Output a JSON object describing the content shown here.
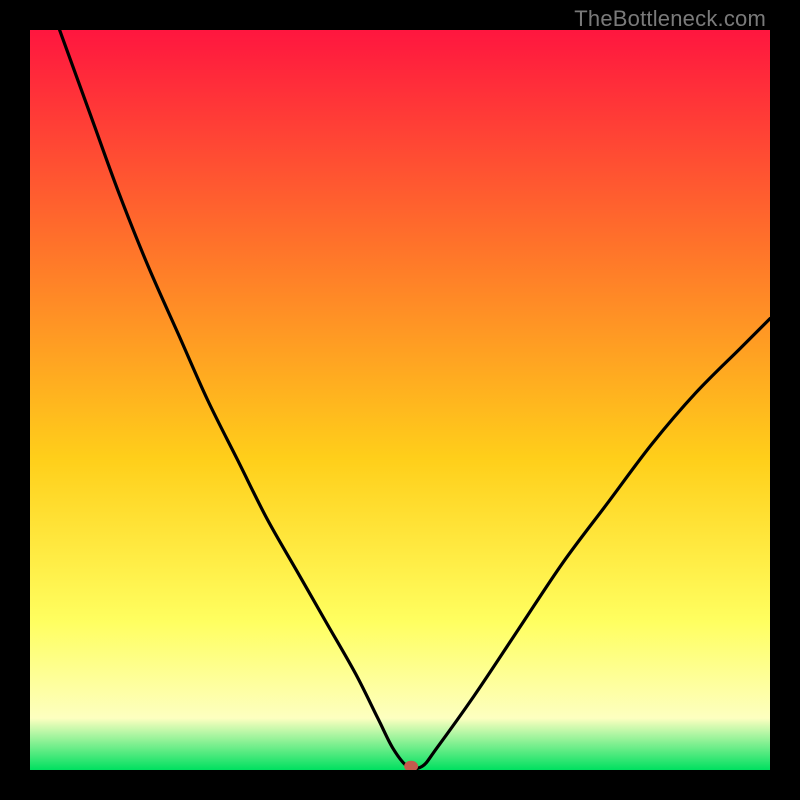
{
  "watermark": "TheBottleneck.com",
  "chart_data": {
    "type": "line",
    "title": "",
    "xlabel": "",
    "ylabel": "",
    "xlim": [
      0,
      100
    ],
    "ylim": [
      0,
      100
    ],
    "grid": false,
    "legend": false,
    "background_gradient": [
      "#ff163f",
      "#ff6f2b",
      "#ffcf1a",
      "#ffff60",
      "#fdffc0",
      "#00e060"
    ],
    "series": [
      {
        "name": "bottleneck-curve",
        "x": [
          4,
          8,
          12,
          16,
          20,
          24,
          28,
          32,
          36,
          40,
          44,
          47,
          49,
          51,
          53,
          55,
          60,
          66,
          72,
          78,
          84,
          90,
          96,
          100
        ],
        "y": [
          100,
          89,
          78,
          68,
          59,
          50,
          42,
          34,
          27,
          20,
          13,
          7,
          3,
          0.5,
          0.5,
          3,
          10,
          19,
          28,
          36,
          44,
          51,
          57,
          61
        ]
      }
    ],
    "marker": {
      "x": 51.5,
      "y": 0.5,
      "color": "#c45a4d"
    }
  }
}
